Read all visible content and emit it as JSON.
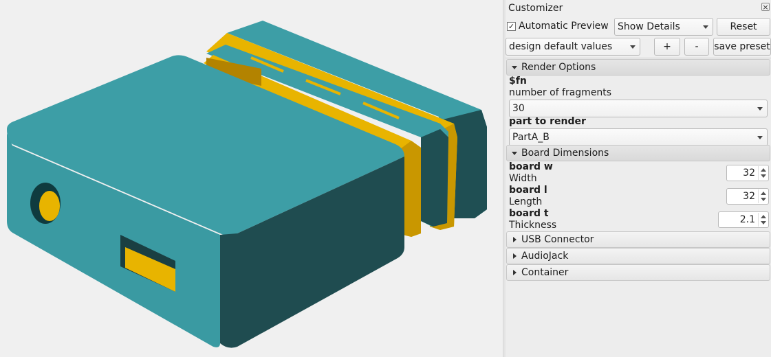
{
  "colors": {
    "teal": "#3b9aa2",
    "teal_dark": "#1f4c50",
    "gold": "#e8b400"
  },
  "customizer": {
    "title": "Customizer",
    "close_icon": "×",
    "auto_preview": {
      "label": "Automatic Preview",
      "checked": true,
      "check_glyph": "✓"
    },
    "details_select": "Show Details",
    "reset_label": "Reset",
    "preset_select": "design default values",
    "add_label": "+",
    "remove_label": "-",
    "save_label": "save preset"
  },
  "groups": {
    "render": {
      "label": "Render Options",
      "params": [
        {
          "name": "$fn",
          "desc": "number of fragments",
          "value": "30"
        },
        {
          "name": "part to render",
          "value": "PartA_B"
        }
      ]
    },
    "board": {
      "label": "Board Dimensions",
      "params": [
        {
          "name": "board w",
          "desc": "Width",
          "value": "32"
        },
        {
          "name": "board l",
          "desc": "Length",
          "value": "32"
        },
        {
          "name": "board t",
          "desc": "Thickness",
          "value": "2.1"
        }
      ]
    },
    "usb": {
      "label": "USB Connector"
    },
    "audio": {
      "label": "AudioJack"
    },
    "container": {
      "label": "Container"
    }
  }
}
